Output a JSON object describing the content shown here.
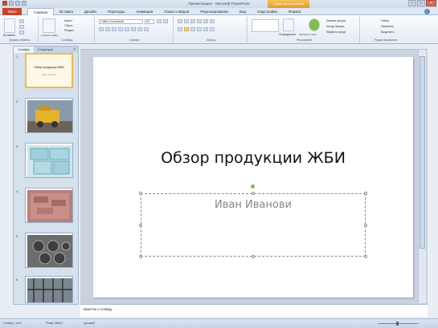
{
  "window": {
    "title": "Презентация1 - Microsoft PowerPoint",
    "contextual_tab": "Средства рисования"
  },
  "tabs": {
    "file": "Файл",
    "items": [
      "Главная",
      "Вставка",
      "Дизайн",
      "Переходы",
      "Анимация",
      "Показ слайдов",
      "Рецензирование",
      "Вид",
      "Надстройки",
      "Формат"
    ]
  },
  "ribbon": {
    "clipboard_label": "Буфер обмена",
    "slides_label": "Слайды",
    "font_label": "Шрифт",
    "paragraph_label": "Абзац",
    "drawing_label": "Рисование",
    "editing_label": "Редактирование",
    "font_name": "Calibri (Основной",
    "font_size": "32",
    "paste_label": "Вставить",
    "create_slide_label": "Создать слайд",
    "layout_label": "Макет",
    "reset_label": "Сброс",
    "section_label": "Раздел",
    "arrange_label": "Упорядочить",
    "quick_styles_label": "Экспресс-стили",
    "fill_label": "Заливка фигуры",
    "outline_label": "Контур фигуры",
    "effects_label": "Эффекты фигур",
    "find_label": "Найти",
    "replace_label": "Заменить",
    "select_label": "Выделить"
  },
  "leftpane": {
    "tab_slides": "Слайды",
    "tab_outline": "Структура",
    "thumb1_title": "Обзор продукции ЖБИ",
    "thumb1_sub": "Иван Иванович",
    "numbers": [
      "1",
      "2",
      "3",
      "4",
      "5",
      "6"
    ]
  },
  "slide": {
    "title": "Обзор продукции ЖБИ",
    "subtitle": "Иван Иванови"
  },
  "notes": {
    "placeholder": "Заметки к слайду"
  },
  "statusbar": {
    "slide_info": "Слайд 1 из 6",
    "theme": "\"Тема Office\"",
    "language": "русский"
  }
}
